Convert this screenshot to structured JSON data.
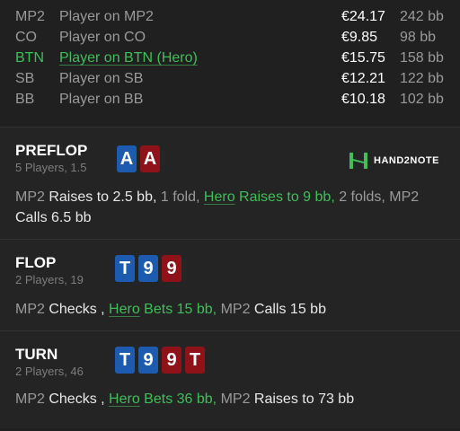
{
  "players": [
    {
      "pos": "MP2",
      "name": "Player on MP2",
      "stack": "€24.17",
      "bb": "242 bb",
      "hero": false
    },
    {
      "pos": "CO",
      "name": "Player on CO",
      "stack": "€9.85",
      "bb": "98 bb",
      "hero": false
    },
    {
      "pos": "BTN",
      "name": "Player on BTN (Hero)",
      "stack": "€15.75",
      "bb": "158 bb",
      "hero": true
    },
    {
      "pos": "SB",
      "name": "Player on SB",
      "stack": "€12.21",
      "bb": "122 bb",
      "hero": false
    },
    {
      "pos": "BB",
      "name": "Player on BB",
      "stack": "€10.18",
      "bb": "102 bb",
      "hero": false
    }
  ],
  "logo": {
    "text": "HAND2NOTE",
    "color": "#3fbf5a"
  },
  "preflop": {
    "title": "PREFLOP",
    "sub": "5 Players, 1.5",
    "cards": [
      {
        "rank": "A",
        "suit": "blue"
      },
      {
        "rank": "A",
        "suit": "red"
      }
    ],
    "a1": "MP2",
    "a2": " Raises to 2.5 bb,",
    "a3": " 1 fold, ",
    "a4": "Hero",
    "a5": " Raises to 9 bb,",
    "a6": " 2 folds, MP2",
    "a7": "Calls 6.5 bb"
  },
  "flop": {
    "title": "FLOP",
    "sub": "2 Players, 19",
    "cards": [
      {
        "rank": "T",
        "suit": "blue"
      },
      {
        "rank": "9",
        "suit": "blue"
      },
      {
        "rank": "9",
        "suit": "red"
      }
    ],
    "a1": "MP2",
    "a2": " Checks , ",
    "a3": "Hero",
    "a4": " Bets 15 bb,",
    "a5": " MP2 ",
    "a6": "Calls 15 bb"
  },
  "turn": {
    "title": "TURN",
    "sub": "2 Players, 46",
    "cards": [
      {
        "rank": "T",
        "suit": "blue"
      },
      {
        "rank": "9",
        "suit": "blue"
      },
      {
        "rank": "9",
        "suit": "red"
      },
      {
        "rank": "T",
        "suit": "red"
      }
    ],
    "a1": "MP2",
    "a2": " Checks , ",
    "a3": "Hero",
    "a4": " Bets 36 bb,",
    "a5": " MP2 ",
    "a6": "Raises to 73 bb"
  }
}
